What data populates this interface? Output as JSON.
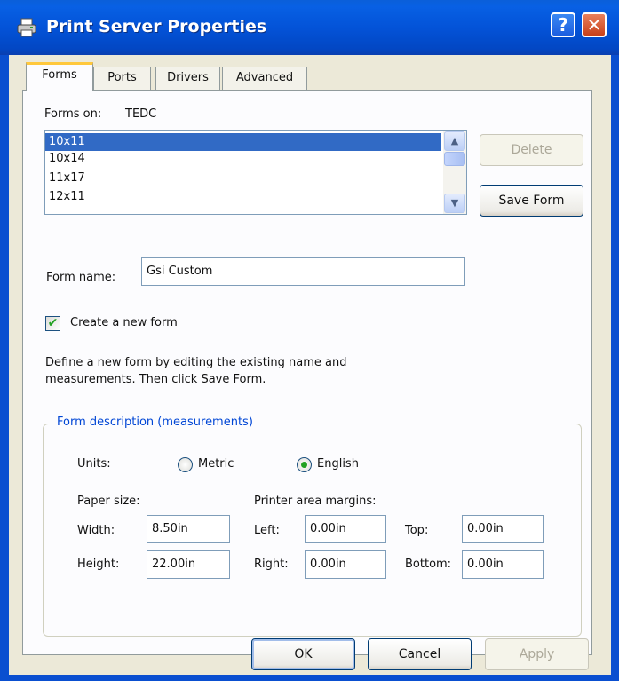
{
  "window": {
    "title": "Print Server Properties"
  },
  "titlebar": {
    "help_glyph": "?",
    "close_glyph": "✕"
  },
  "tabs": [
    {
      "label": "Forms",
      "active": true
    },
    {
      "label": "Ports",
      "active": false
    },
    {
      "label": "Drivers",
      "active": false
    },
    {
      "label": "Advanced",
      "active": false
    }
  ],
  "forms": {
    "forms_on_label": "Forms on:",
    "server_name": "TEDC",
    "list": [
      "10x11",
      "10x14",
      "11x17",
      "12x11"
    ],
    "selected_index": 0,
    "delete_label": "Delete",
    "save_form_label": "Save Form",
    "form_name_label": "Form name:",
    "form_name_value": "Gsi Custom",
    "create_new_form_label": "Create a new form",
    "create_new_form_checked": true,
    "help_text_line1": "Define a new form by editing the existing name and",
    "help_text_line2": "measurements.  Then click Save Form."
  },
  "measurements": {
    "group_title": "Form description (measurements)",
    "units_label": "Units:",
    "metric_label": "Metric",
    "english_label": "English",
    "selected_unit": "English",
    "paper_size_label": "Paper size:",
    "printer_area_label": "Printer area margins:",
    "width_label": "Width:",
    "width_value": "8.50in",
    "height_label": "Height:",
    "height_value": "22.00in",
    "left_label": "Left:",
    "left_value": "0.00in",
    "right_label": "Right:",
    "right_value": "0.00in",
    "top_label": "Top:",
    "top_value": "0.00in",
    "bottom_label": "Bottom:",
    "bottom_value": "0.00in"
  },
  "footer": {
    "ok_label": "OK",
    "cancel_label": "Cancel",
    "apply_label": "Apply"
  },
  "icons": {
    "title_icon": "printer-icon",
    "scroll_up": "chevron-up-icon",
    "scroll_down": "chevron-down-icon",
    "checkmark": "checkmark-icon"
  },
  "colors": {
    "titlebar": "#0353d8",
    "selection": "#316ac5",
    "group_title": "#0046d5",
    "check_green": "#21a121"
  }
}
